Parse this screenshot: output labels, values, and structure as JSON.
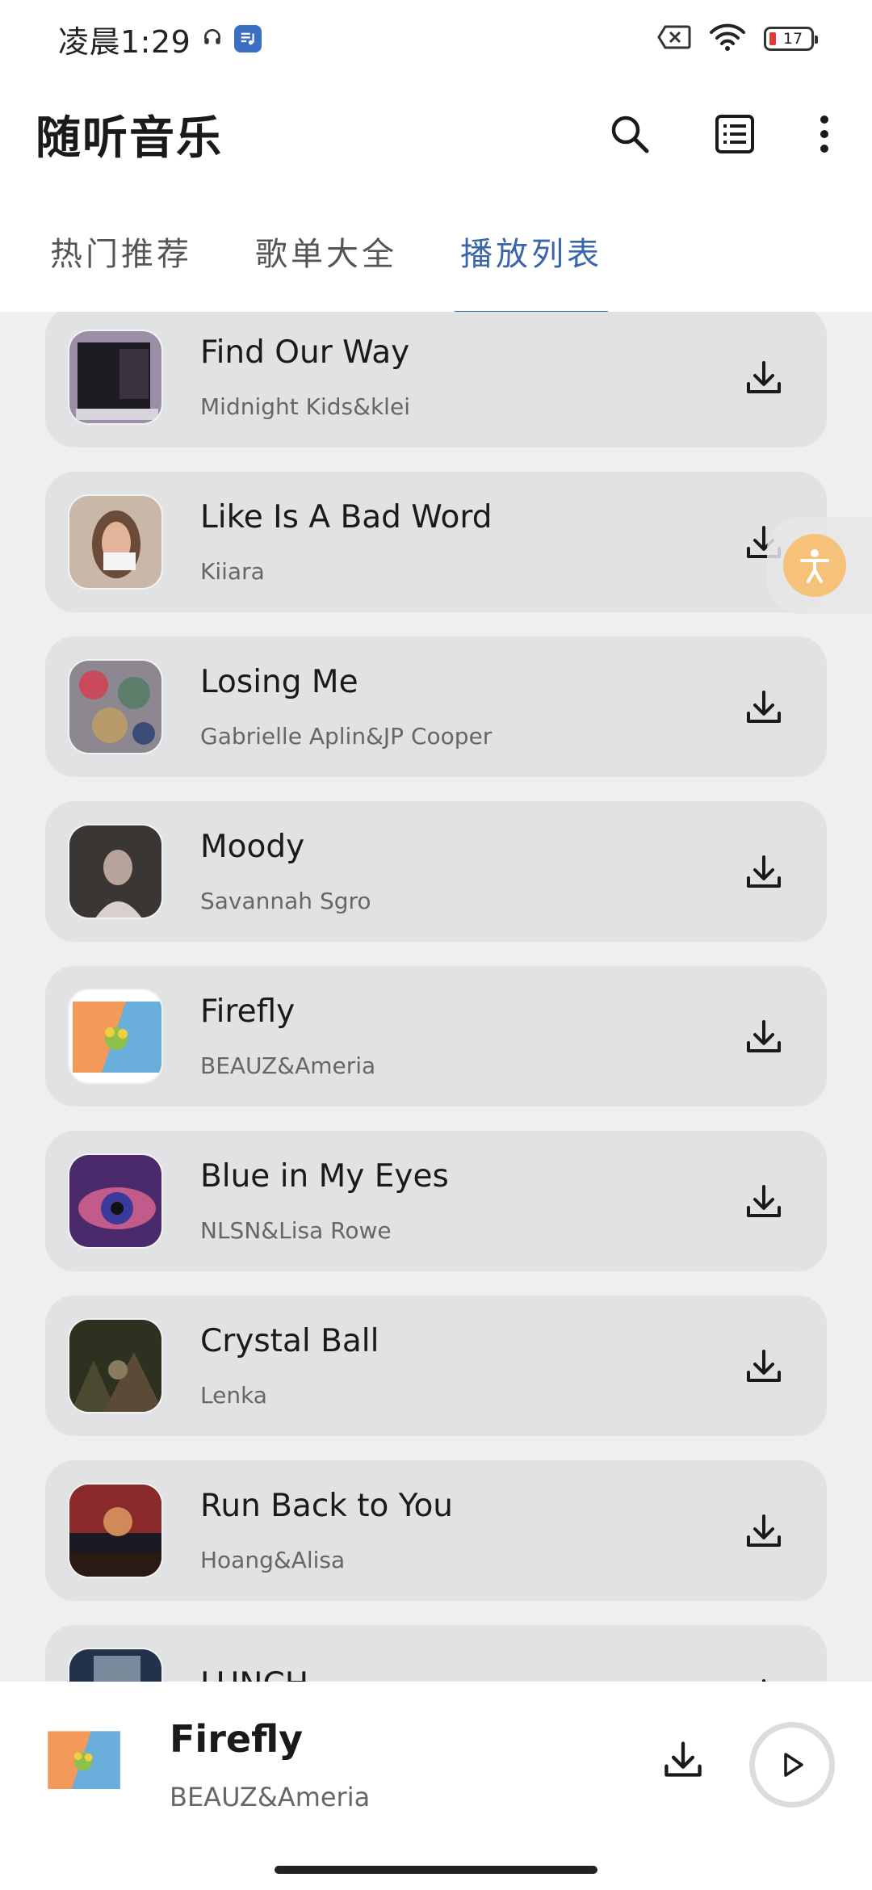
{
  "status_bar": {
    "time": "凌晨1:29",
    "battery_level": "17",
    "battery_color": "#e53935"
  },
  "app_bar": {
    "title": "随听音乐",
    "icons": [
      "search-icon",
      "list-icon",
      "more-vert-icon"
    ]
  },
  "tabs": [
    {
      "label": "热门推荐",
      "active": false
    },
    {
      "label": "歌单大全",
      "active": false
    },
    {
      "label": "播放列表",
      "active": true
    }
  ],
  "accent_color": "#3a65a8",
  "songs": [
    {
      "title": "Find Our Way",
      "artist": "Midnight Kids&klei"
    },
    {
      "title": "Like Is A Bad Word",
      "artist": "Kiiara"
    },
    {
      "title": "Losing Me",
      "artist": "Gabrielle Aplin&JP Cooper"
    },
    {
      "title": "Moody",
      "artist": "Savannah Sgro"
    },
    {
      "title": "Firefly",
      "artist": "BEAUZ&Ameria"
    },
    {
      "title": "Blue in My Eyes",
      "artist": "NLSN&Lisa Rowe"
    },
    {
      "title": "Crystal Ball",
      "artist": "Lenka"
    },
    {
      "title": "Run Back to You",
      "artist": "Hoang&Alisa"
    },
    {
      "title": "LUNCH",
      "artist": ""
    }
  ],
  "player": {
    "title": "Firefly",
    "artist": "BEAUZ&Ameria"
  }
}
